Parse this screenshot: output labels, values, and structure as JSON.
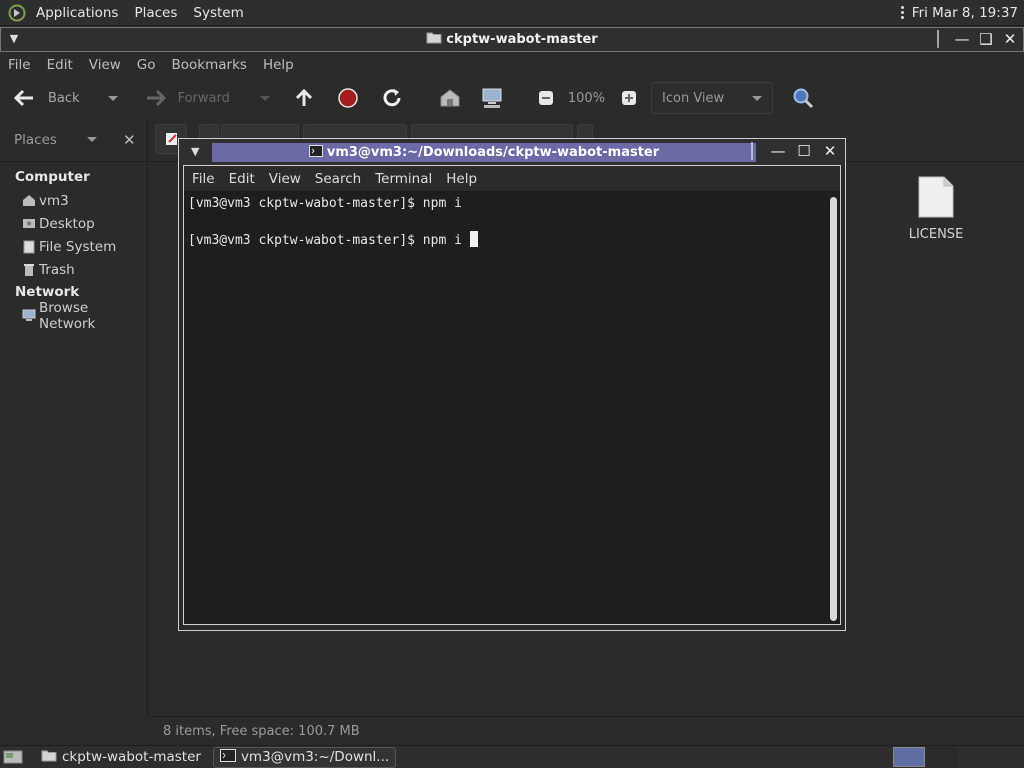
{
  "top_panel": {
    "menus": [
      "Applications",
      "Places",
      "System"
    ],
    "clock": "Fri Mar  8, 19:37"
  },
  "fm_window": {
    "title": "ckptw-wabot-master",
    "menus": [
      "File",
      "Edit",
      "View",
      "Go",
      "Bookmarks",
      "Help"
    ],
    "toolbar": {
      "back_label": "Back",
      "forward_label": "Forward",
      "zoom_level": "100%",
      "view_mode": "Icon View"
    },
    "sidebar": {
      "header": "Places",
      "sections": [
        {
          "title": "Computer",
          "items": [
            "vm3",
            "Desktop",
            "File System",
            "Trash"
          ]
        },
        {
          "title": "Network",
          "items": [
            "Browse Network"
          ]
        }
      ]
    },
    "files": [
      {
        "name": "LICENSE"
      }
    ],
    "status": "8 items, Free space: 100.7 MB"
  },
  "terminal": {
    "title": "vm3@vm3:~/Downloads/ckptw-wabot-master",
    "menus": [
      "File",
      "Edit",
      "View",
      "Search",
      "Terminal",
      "Help"
    ],
    "lines": [
      "[vm3@vm3 ckptw-wabot-master]$ npm i",
      "",
      "[vm3@vm3 ckptw-wabot-master]$ npm i "
    ]
  },
  "taskbar": {
    "tasks": [
      "ckptw-wabot-master",
      "vm3@vm3:~/Downl..."
    ]
  }
}
